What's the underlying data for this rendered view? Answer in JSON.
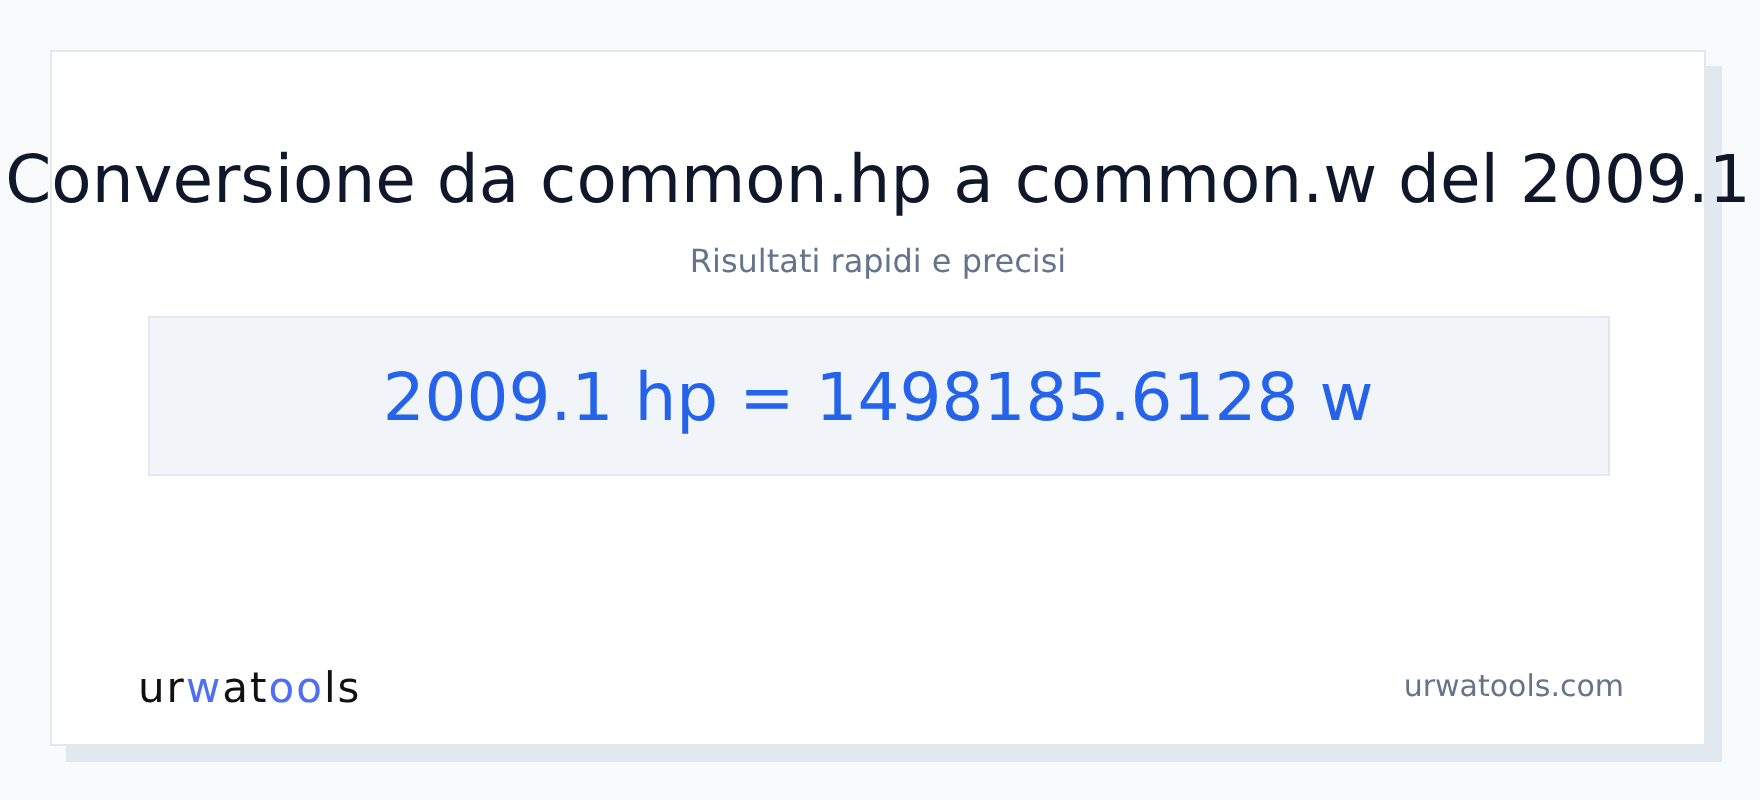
{
  "title": "Conversione da common.hp a common.w del 2009.1",
  "subtitle": "Risultati rapidi e precisi",
  "result": "2009.1 hp = 1498185.6128 w",
  "logo": [
    {
      "text": "ur",
      "accent": false
    },
    {
      "text": "w",
      "accent": true
    },
    {
      "text": "at",
      "accent": false
    },
    {
      "text": "oo",
      "accent": true
    },
    {
      "text": "ls",
      "accent": false
    }
  ],
  "site": "urwatools.com"
}
